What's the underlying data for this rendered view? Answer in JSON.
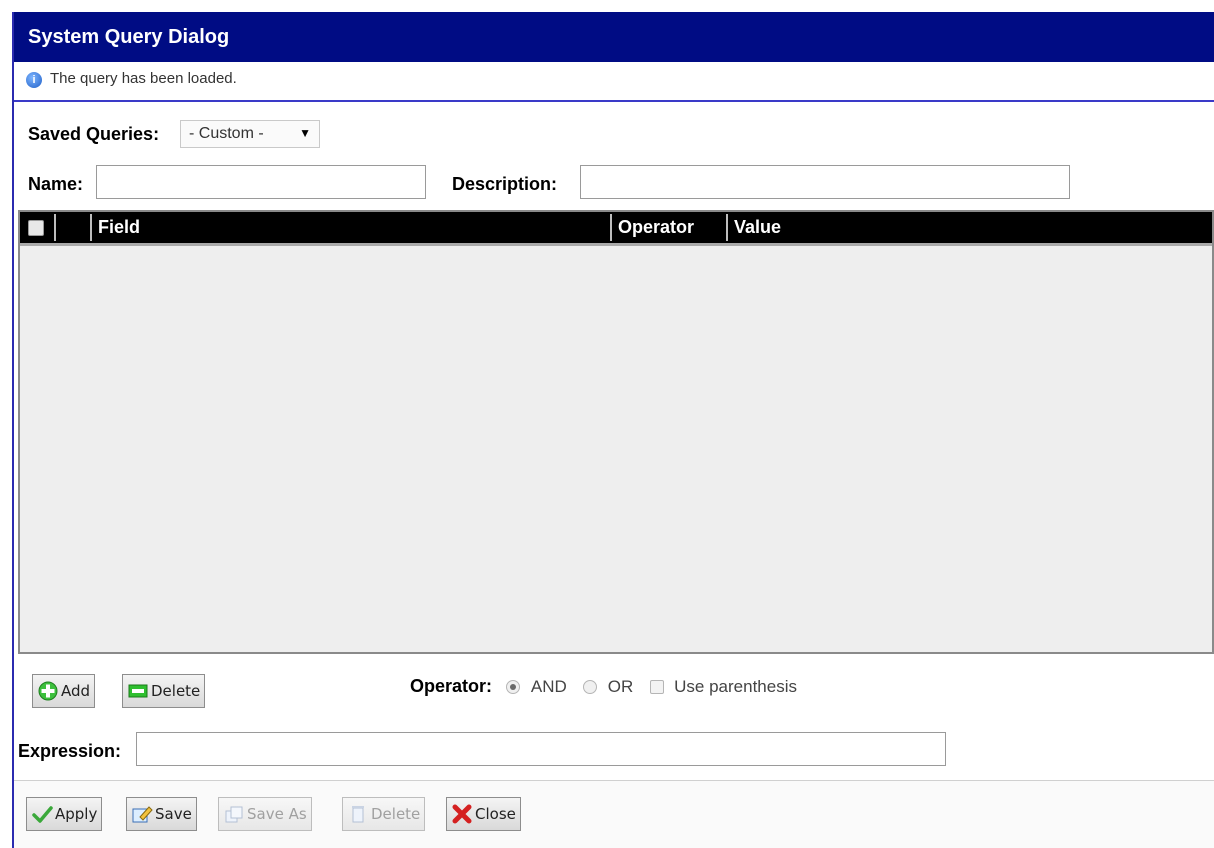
{
  "dialog": {
    "title": "System Query Dialog",
    "status_message": "The query has been loaded."
  },
  "saved_queries": {
    "label": "Saved Queries:",
    "selected": "- Custom -"
  },
  "name": {
    "label": "Name:",
    "value": ""
  },
  "description": {
    "label": "Description:",
    "value": ""
  },
  "grid": {
    "columns": [
      "Field",
      "Operator",
      "Value"
    ],
    "rows": []
  },
  "row_actions": {
    "add_label": "Add",
    "delete_label": "Delete"
  },
  "operator": {
    "label": "Operator:",
    "options": [
      "AND",
      "OR"
    ],
    "selected": "AND",
    "parenthesis_label": "Use parenthesis",
    "parenthesis_checked": false
  },
  "expression": {
    "label": "Expression:",
    "value": ""
  },
  "footer": {
    "apply_label": "Apply",
    "save_label": "Save",
    "save_as_label": "Save As",
    "delete_label": "Delete",
    "close_label": "Close"
  },
  "colors": {
    "title_bar": "#000c84",
    "grid_header": "#000000",
    "grid_body": "#eeeeee"
  }
}
